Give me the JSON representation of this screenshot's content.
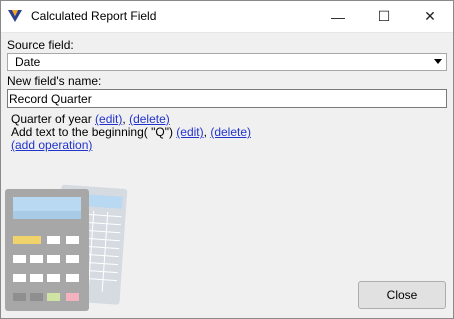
{
  "window": {
    "title": "Calculated Report Field",
    "minimize_glyph": "—",
    "maximize_glyph": "☐",
    "close_glyph": "✕"
  },
  "source_field": {
    "label": "Source field:",
    "value": "Date"
  },
  "new_field_name": {
    "label": "New field's name:",
    "value": "Record Quarter"
  },
  "operations": [
    {
      "text": "Quarter of year",
      "edit": "(edit)",
      "sep": ",",
      "delete": "(delete)"
    },
    {
      "text": "Add text to the beginning( \"Q\")",
      "edit": "(edit)",
      "sep": ",",
      "delete": "(delete)"
    }
  ],
  "add_operation": "(add operation)",
  "buttons": {
    "close": "Close"
  }
}
